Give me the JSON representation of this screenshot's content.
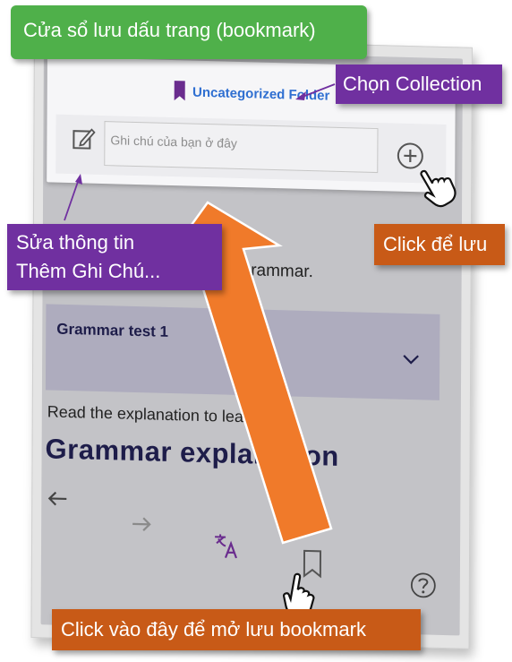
{
  "title_badge": "Cửa sổ lưu dấu trang (bookmark)",
  "popup": {
    "collection_name": "Uncategorized Folder",
    "note_placeholder": "Ghi chú của bạn ở đây"
  },
  "page": {
    "grammar_text": "grammar.",
    "accordion_label": "Grammar test 1",
    "explanation_text": "Read the explanation to learn m",
    "heading": "Grammar explanation"
  },
  "callouts": {
    "choose_collection": "Chọn Collection",
    "edit_info": "Sửa thông tin\nThêm Ghi Chú...",
    "edit_line1": "Sửa thông tin",
    "edit_line2": "Thêm Ghi Chú...",
    "click_save": "Click để lưu",
    "click_open": "Click vào đây để mở lưu bookmark"
  },
  "icons": {
    "collection": "bookmark-icon",
    "edit": "edit-note-icon",
    "add": "plus-circle-icon",
    "back": "arrow-left-icon",
    "forward": "arrow-right-icon",
    "translate": "translate-icon",
    "bookmark_nav": "bookmark-outline-icon",
    "help": "help-icon",
    "hand": "hand-pointer-icon"
  },
  "colors": {
    "accent_blue": "#2f6fd1",
    "bookmark_purple": "#6a2c8e",
    "callout_purple": "#7030a0",
    "callout_orange": "#c85a17",
    "title_green": "#4fb04a",
    "arrow_orange": "#f07a2a"
  }
}
